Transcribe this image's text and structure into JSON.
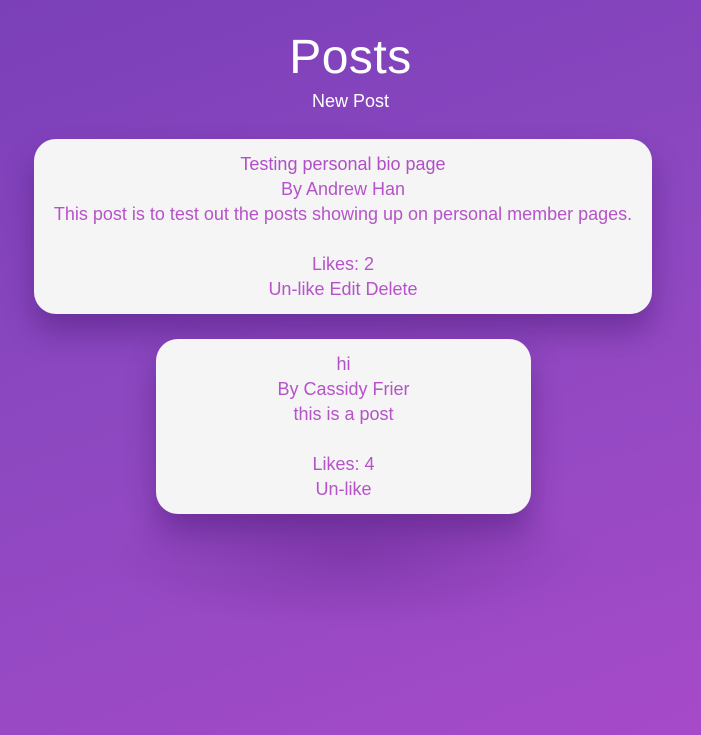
{
  "header": {
    "title": "Posts",
    "new_post_label": "New Post"
  },
  "posts": [
    {
      "title": "Testing personal bio page",
      "author": "By Andrew Han",
      "body": "This post is to test out the posts showing up on personal member pages.",
      "likes": "Likes: 2",
      "actions": {
        "unlike": "Un-like",
        "edit": "Edit",
        "delete": "Delete"
      }
    },
    {
      "title": "hi",
      "author": "By Cassidy Frier",
      "body": "this is a post",
      "likes": "Likes: 4",
      "actions": {
        "unlike": "Un-like"
      }
    }
  ],
  "colors": {
    "background_start": "#7b3fb8",
    "background_end": "#a64ac9",
    "card_background": "#f5f5f5",
    "card_text": "#b653c9"
  }
}
